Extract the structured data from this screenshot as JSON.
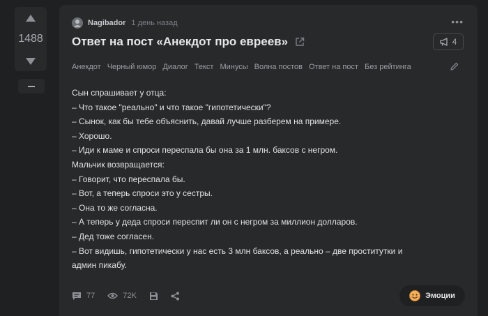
{
  "rating": {
    "score": "1488"
  },
  "post": {
    "author": "Nagibador",
    "time": "1 день назад",
    "title": "Ответ на пост «Анекдот про евреев»",
    "share_count": "4",
    "tags": [
      "Анекдот",
      "Черный юмор",
      "Диалог",
      "Текст",
      "Минусы",
      "Волна постов",
      "Ответ на пост",
      "Без рейтинга"
    ],
    "lines": [
      "Сын спрашивает у отца:",
      "– Что такое \"реально\" и что такое \"гипотетически\"?",
      "– Сынок, как бы тебе объяснить, давай лучше разберем на примере.",
      "– Хорошо.",
      "– Иди к маме и спроси переспала бы она за 1 млн. баксов с негром.",
      "Мальчик возвращается:",
      "– Говорит, что переспала бы.",
      "– Вот, а теперь спроси это у сестры.",
      "– Она то же согласна.",
      "– А теперь у деда спроси переспит ли он с негром за миллион долларов.",
      "– Дед тоже согласен.",
      "– Вот видишь, гипотетически у нас есть 3 млн баксов, а реально – две проститутки и",
      "админ пикабу."
    ]
  },
  "footer": {
    "comments": "77",
    "views": "72K",
    "emotions_label": "Эмоции"
  },
  "icons": {
    "comment": "comment-icon",
    "views": "eye-icon",
    "save": "save-icon",
    "share": "share-icon",
    "emotions": "smiley-icon"
  },
  "colors": {
    "background": "#1f2022",
    "card": "#28292b",
    "text": "#e1e2e4",
    "muted": "#8d9197"
  }
}
